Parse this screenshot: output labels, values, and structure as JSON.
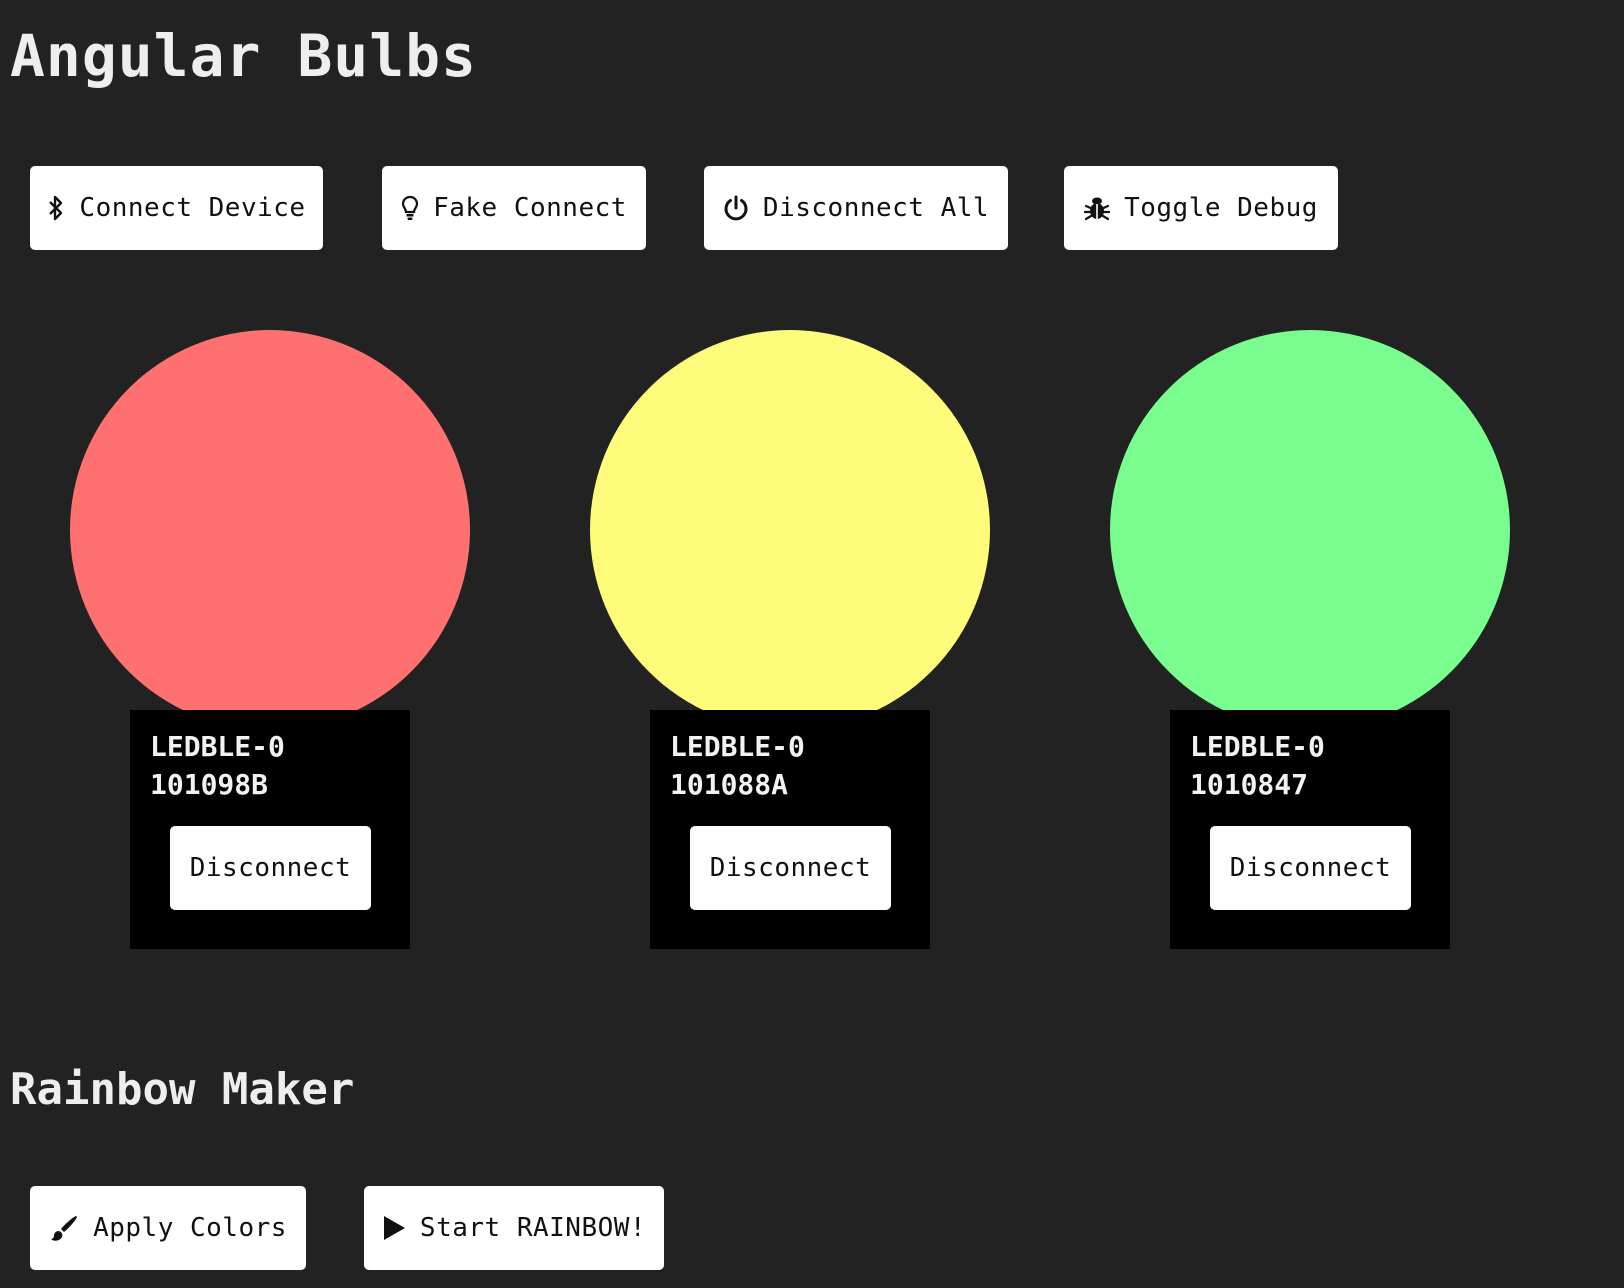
{
  "app": {
    "title": "Angular Bulbs"
  },
  "toolbar": {
    "connect": {
      "label": "Connect Device",
      "icon": "bluetooth-icon"
    },
    "fake": {
      "label": "Fake Connect",
      "icon": "lightbulb-icon"
    },
    "disconnect_all": {
      "label": "Disconnect All",
      "icon": "power-icon"
    },
    "debug": {
      "label": "Toggle Debug",
      "icon": "bug-icon"
    }
  },
  "bulbs": [
    {
      "name": "LEDBLE-0101098B",
      "color": "#ff7070",
      "button": "Disconnect"
    },
    {
      "name": "LEDBLE-0101088A",
      "color": "#fffb7b",
      "button": "Disconnect"
    },
    {
      "name": "LEDBLE-01010847",
      "color": "#78fd8e",
      "button": "Disconnect"
    }
  ],
  "rainbow": {
    "title": "Rainbow Maker",
    "apply": {
      "label": "Apply Colors",
      "icon": "paintbrush-icon"
    },
    "start": {
      "label": "Start RAINBOW!",
      "icon": "play-icon"
    }
  }
}
